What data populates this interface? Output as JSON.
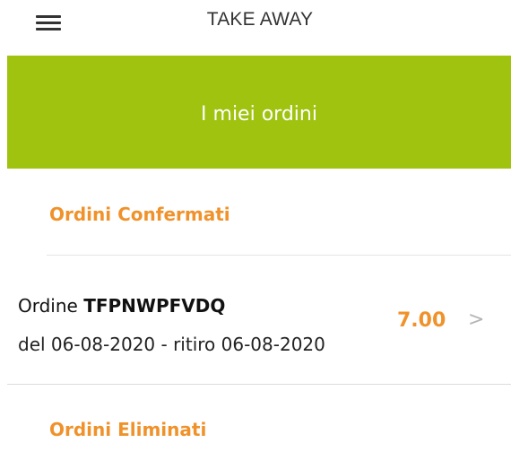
{
  "header": {
    "menu_icon": "hamburger-menu-icon",
    "title": "TAKE AWAY"
  },
  "banner": {
    "title": "I miei ordini",
    "color": "#9fc30f"
  },
  "sections": {
    "confirmed": {
      "title": "Ordini Confermati",
      "orders": [
        {
          "prefix": "Ordine ",
          "code": "TFPNWPFVDQ",
          "dates": "del 06-08-2020 - ritiro 06-08-2020",
          "amount": "7.00",
          "chevron": ">"
        }
      ]
    },
    "deleted": {
      "title": "Ordini Eliminati"
    }
  },
  "colors": {
    "accent": "#f0922b",
    "banner": "#9fc30f"
  }
}
